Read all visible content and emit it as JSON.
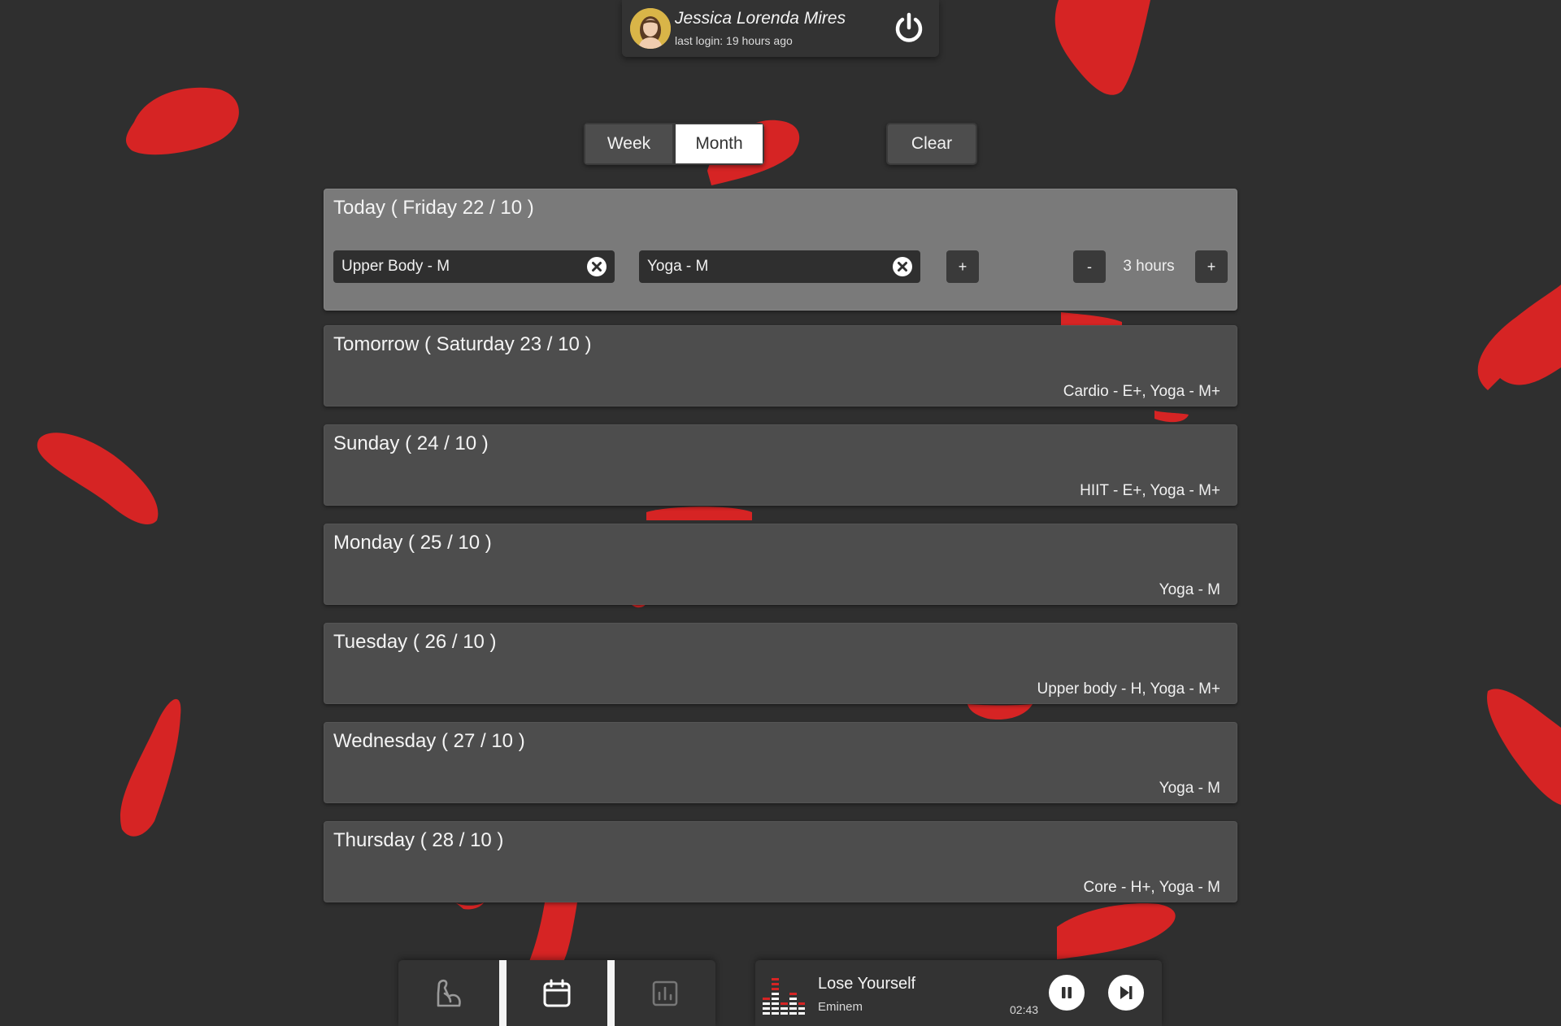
{
  "user": {
    "name": "Jessica Lorenda Mires",
    "last_login": "last login:  19 hours ago",
    "avatar_icon": "avatar",
    "logout_icon": "power-icon"
  },
  "view_toggle": {
    "week_label": "Week",
    "month_label": "Month",
    "selected": "Month"
  },
  "clear_label": "Clear",
  "today": {
    "title": "Today ( Friday 22 / 10 )",
    "workouts": [
      "Upper Body - M",
      "Yoga - M"
    ],
    "add_label": "+",
    "hours_minus_label": "-",
    "hours_value": "3 hours",
    "hours_plus_label": "+"
  },
  "days": [
    {
      "title": "Tomorrow ( Saturday 23 / 10 )",
      "workouts": "Cardio - E+, Yoga - M+"
    },
    {
      "title": "Sunday ( 24 / 10 )",
      "workouts": "HIIT - E+, Yoga - M+"
    },
    {
      "title": "Monday ( 25 / 10 )",
      "workouts": "Yoga - M"
    },
    {
      "title": "Tuesday ( 26 / 10 )",
      "workouts": "Upper body - H, Yoga - M+"
    },
    {
      "title": "Wednesday ( 27 / 10 )",
      "workouts": "Yoga - M"
    },
    {
      "title": "Thursday ( 28 / 10 )",
      "workouts": "Core - H+, Yoga - M"
    }
  ],
  "bottom_nav": {
    "items": [
      "muscle-icon",
      "calendar-icon",
      "bar-chart-icon"
    ],
    "active": "calendar-icon"
  },
  "player": {
    "title": "Lose Yourself",
    "artist": "Eminem",
    "time": "02:43",
    "icons": [
      "equalizer-icon",
      "pause-icon",
      "skip-next-icon"
    ]
  },
  "colors": {
    "background": "#2f2f2f",
    "accent": "#d62424",
    "card": "#4d4d4d",
    "today_card": "#7a7a7a"
  }
}
